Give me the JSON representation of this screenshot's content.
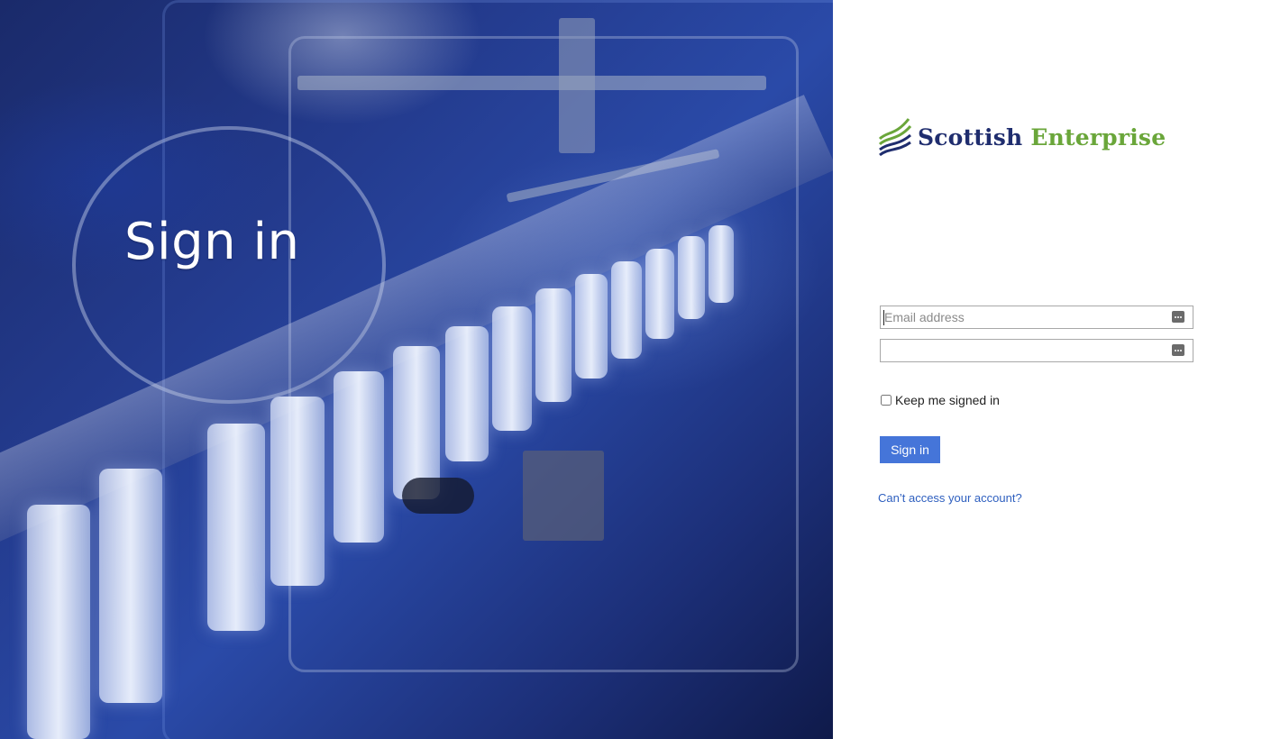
{
  "hero": {
    "title": "Sign in"
  },
  "brand": {
    "name_part1": "Scottish",
    "name_part2": "Enterprise",
    "colors": {
      "navy": "#1f2d6e",
      "green": "#6aa63a"
    }
  },
  "form": {
    "email_placeholder": "Email address",
    "email_value": "",
    "password_value": "",
    "field_icon": "password-manager-key-icon",
    "keep_signed_in_label": "Keep me signed in",
    "keep_signed_in_checked": false,
    "submit_label": "Sign in",
    "help_link": "Can’t access your account?"
  },
  "theme": {
    "accent": "#4575d9",
    "link": "#2e5fbf"
  }
}
